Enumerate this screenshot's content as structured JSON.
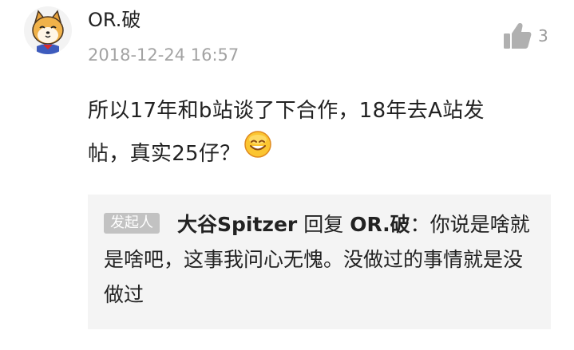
{
  "comment": {
    "username": "OR.破",
    "timestamp": "2018-12-24 16:57",
    "like_count": "3",
    "content_line1": "所以17年和b站谈了下合作，18年去A站发",
    "content_line2": "帖，真实25仔？",
    "avatar_icon": "shiba-dog-avatar",
    "like_icon": "thumbs-up-icon",
    "emoji_icon": "smile-emoji-icon"
  },
  "reply": {
    "badge": "发起人",
    "author": "大谷Spitzer",
    "reply_word": "回复",
    "target": "OR.破",
    "separator": "：",
    "text": "你说是啥就是啥吧，这事我问心无愧。没做过的事情就是没做过"
  },
  "colors": {
    "background": "#ffffff",
    "text": "#222222",
    "muted": "#a3a3a3",
    "reply_bg": "#f4f4f4",
    "badge_bg": "#c2c2c2",
    "like_icon": "#b0b0b0"
  }
}
